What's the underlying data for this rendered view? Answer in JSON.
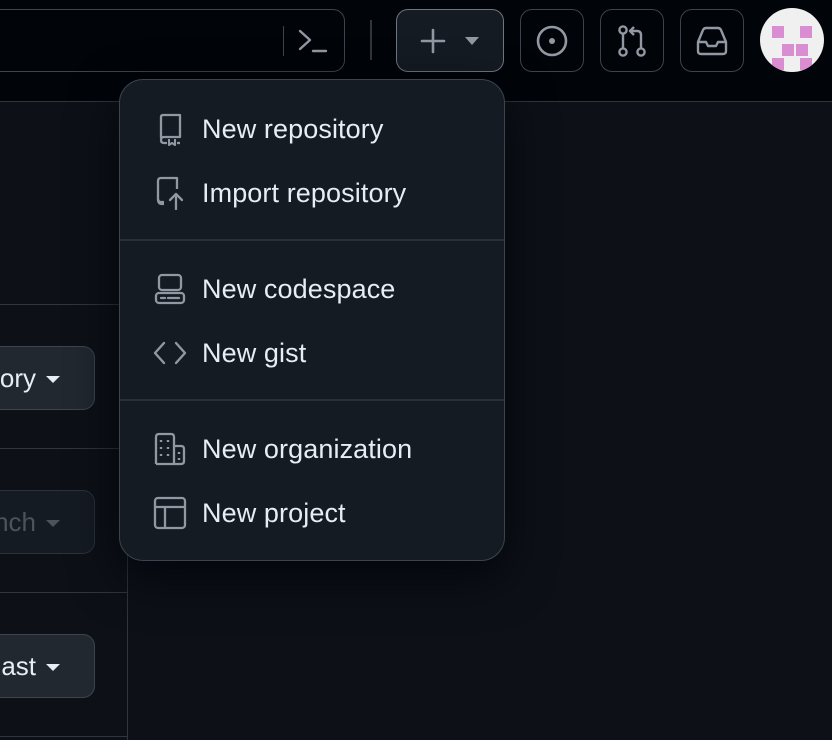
{
  "header": {
    "create_menu_open": true
  },
  "left_panel": {
    "buttons": [
      {
        "label": "ory",
        "disabled": false
      },
      {
        "label": "nch",
        "disabled": true
      },
      {
        "label": "ast",
        "disabled": false
      }
    ]
  },
  "create_menu": {
    "groups": [
      {
        "items": [
          {
            "label": "New repository",
            "icon": "repo-icon"
          },
          {
            "label": "Import repository",
            "icon": "repo-push-icon"
          }
        ]
      },
      {
        "items": [
          {
            "label": "New codespace",
            "icon": "codespaces-icon"
          },
          {
            "label": "New gist",
            "icon": "code-icon"
          }
        ]
      },
      {
        "items": [
          {
            "label": "New organization",
            "icon": "organization-icon"
          },
          {
            "label": "New project",
            "icon": "table-icon"
          }
        ]
      }
    ]
  },
  "colors": {
    "background": "#0d1117",
    "header_background": "#010409",
    "menu_background": "#151b23",
    "border": "#3d444d",
    "text": "#e6edf3",
    "icon": "#9198a1"
  }
}
